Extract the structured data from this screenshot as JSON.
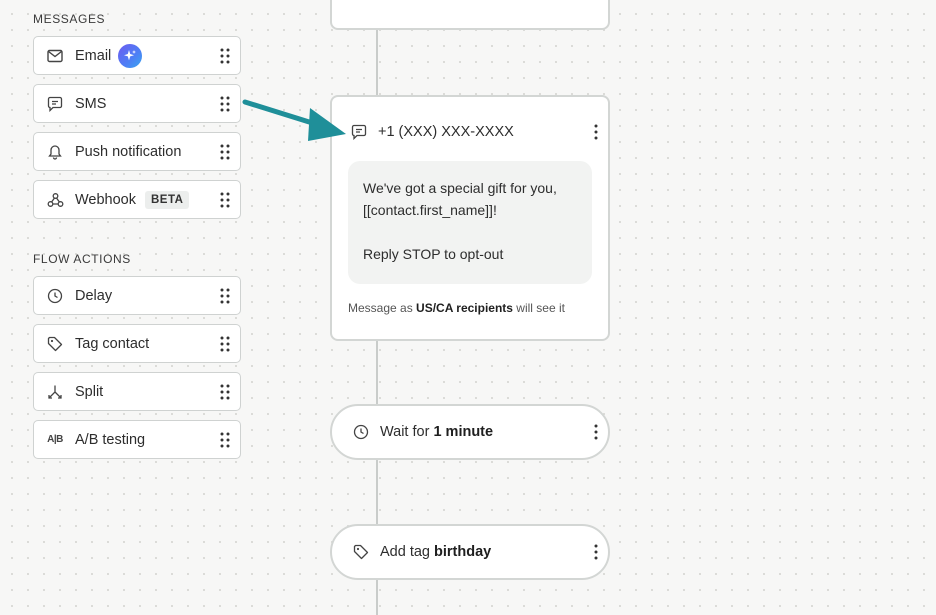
{
  "sidebar": {
    "messages_title": "MESSAGES",
    "flow_actions_title": "FLOW ACTIONS",
    "messages": [
      {
        "label": "Email",
        "icon": "mail-icon"
      },
      {
        "label": "SMS",
        "icon": "chat-bubble-icon"
      },
      {
        "label": "Push notification",
        "icon": "bell-icon"
      },
      {
        "label": "Webhook",
        "icon": "webhook-icon",
        "badge": "BETA"
      }
    ],
    "flow_actions": [
      {
        "label": "Delay",
        "icon": "clock-icon"
      },
      {
        "label": "Tag contact",
        "icon": "tag-icon"
      },
      {
        "label": "Split",
        "icon": "split-icon"
      },
      {
        "label": "A/B testing",
        "icon": "ab-icon",
        "icon_text": "A|B"
      }
    ]
  },
  "canvas": {
    "sms_card": {
      "phone": "+1 (XXX) XXX-XXXX",
      "message": "We've got a special gift for you,\n[[contact.first_name]]!\n\nReply STOP to opt-out",
      "footer_prefix": "Message as ",
      "footer_strong": "US/CA recipients",
      "footer_suffix": " will see it"
    },
    "wait_card": {
      "prefix": "Wait for ",
      "value": "1 minute"
    },
    "tag_card": {
      "prefix": "Add tag ",
      "value": "birthday"
    }
  },
  "colors": {
    "arrow": "#1f8f99",
    "ai_gradient_start": "#6d5cf0",
    "ai_gradient_end": "#3aa6f0",
    "card_border": "#d3d6d4"
  }
}
